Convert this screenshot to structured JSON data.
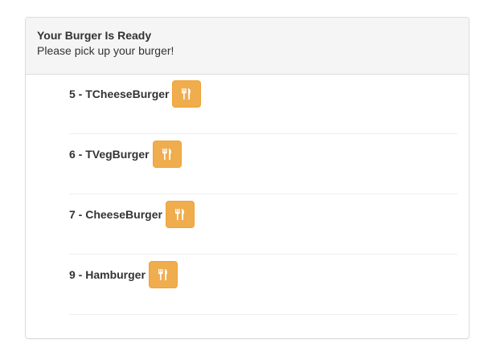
{
  "panel": {
    "title": "Your Burger Is Ready",
    "subtitle": "Please pick up your burger!"
  },
  "orders": [
    {
      "label": "5 - TCheeseBurger",
      "icon": "cutlery-icon"
    },
    {
      "label": "6 - TVegBurger",
      "icon": "cutlery-icon"
    },
    {
      "label": "7 - CheeseBurger",
      "icon": "cutlery-icon"
    },
    {
      "label": "9 - Hamburger",
      "icon": "cutlery-icon"
    }
  ],
  "colors": {
    "button_bg": "#f0ad4e",
    "button_border": "#eea236",
    "heading_bg": "#f5f5f5"
  }
}
